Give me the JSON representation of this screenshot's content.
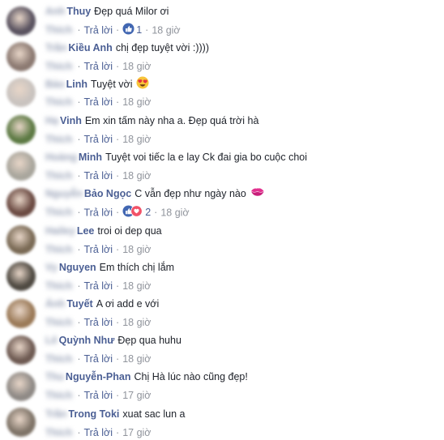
{
  "comments": [
    {
      "blurred_prefix": "Anh",
      "name": "Thuy",
      "text": "Đẹp quá Milor ơi",
      "blurred_line2": "Thích",
      "reply": "Trả lời",
      "reactions": {
        "types": [
          "like"
        ],
        "count": "1"
      },
      "time": "18 giờ",
      "avatar_color": "#5a5360"
    },
    {
      "blurred_prefix": "Trần",
      "name": "Kiều Anh",
      "text": "chị đẹp tuyệt vời :))))",
      "blurred_line2": "Thích",
      "reply": "Trả lời",
      "time": "18 giờ",
      "avatar_color": "#8c7a72"
    },
    {
      "blurred_prefix": "Bảo",
      "name": "Linh",
      "text": "Tuyệt vời",
      "emoji": "heart-eyes",
      "blurred_line2": "Thích",
      "reply": "Trả lời",
      "time": "18 giờ",
      "avatar_color": "#c9c3bf"
    },
    {
      "blurred_prefix": "Hạ",
      "name": "Vinh",
      "text": "Em xin tấm này nha a. Đẹp quá trời hà",
      "blurred_line2": "Thích",
      "reply": "Trả lời",
      "time": "18 giờ",
      "avatar_color": "#5d7a44"
    },
    {
      "blurred_prefix": "Hoàng",
      "name": "Minh",
      "text": "Tuyệt voi tiếc la e lay Ck đai gia bo cuộc choi",
      "blurred_line2": "Thích",
      "reply": "Trả lời",
      "time": "18 giờ",
      "avatar_color": "#a9a69d"
    },
    {
      "blurred_prefix": "Nguyễn",
      "name": "Bảo Ngọc",
      "text": "C vẫn đẹp như ngày nào",
      "emoji": "kiss",
      "blurred_line2": "Thích",
      "reply": "Trả lời",
      "reactions": {
        "types": [
          "like",
          "love"
        ],
        "count": "2"
      },
      "time": "18 giờ",
      "avatar_color": "#6b4a42"
    },
    {
      "blurred_prefix": "Hailey",
      "name": "Lee",
      "text": "troi oi dep qua",
      "blurred_line2": "Thích",
      "reply": "Trả lời",
      "time": "18 giờ",
      "avatar_color": "#7a6a55"
    },
    {
      "blurred_prefix": "Vy",
      "name": "Nguyen",
      "text": "Em thích chị lắm",
      "blurred_line2": "Thích",
      "reply": "Trả lời",
      "time": "18 giờ",
      "avatar_color": "#4f4a42"
    },
    {
      "blurred_prefix": "Ánh",
      "name": "Tuyết",
      "text": "A ơi add e với",
      "blurred_line2": "Thích",
      "reply": "Trả lời",
      "time": "18 giờ",
      "avatar_color": "#9b7a58"
    },
    {
      "blurred_prefix": "Lê",
      "name": "Quỳnh Như",
      "text": "Đẹp qua huhu",
      "blurred_line2": "Thích",
      "reply": "Trả lời",
      "time": "18 giờ",
      "avatar_color": "#6e5a52"
    },
    {
      "blurred_prefix": "Thu",
      "name": "Nguyễn-Phan",
      "text": "Chị Hà lúc nào cũng đẹp!",
      "blurred_line2": "Thích",
      "reply": "Trả lời",
      "time": "17 giờ",
      "avatar_color": "#8f8a86"
    },
    {
      "blurred_prefix": "Trần",
      "name": "Trong Toki",
      "text": "xuat sac lun a",
      "blurred_line2": "Thích",
      "reply": "Trả lời",
      "time": "17 giờ",
      "avatar_color": "#7f7468"
    }
  ],
  "colors": {
    "name": "#4b5f94",
    "text": "#1d2129",
    "meta": "#90949c",
    "like": "#4267b2",
    "love": "#f25268"
  }
}
